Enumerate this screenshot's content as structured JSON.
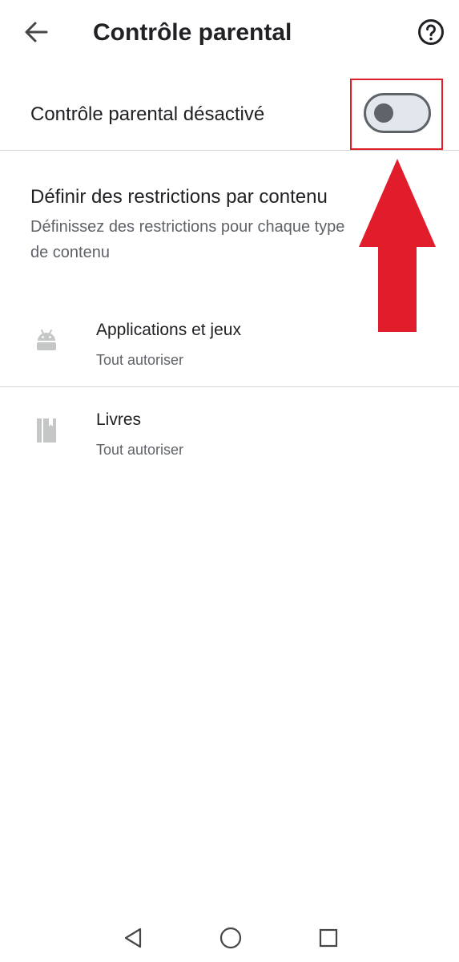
{
  "app_bar": {
    "title": "Contrôle parental",
    "back_icon": "arrow-back-icon",
    "help_icon": "help-circle-icon"
  },
  "parental_toggle": {
    "label": "Contrôle parental désactivé",
    "enabled": false
  },
  "restrictions": {
    "title": "Définir des restrictions par contenu",
    "description": "Définissez des restrictions pour chaque type de contenu"
  },
  "content_items": [
    {
      "title": "Applications et jeux",
      "subtitle": "Tout autoriser",
      "icon": "android-icon"
    },
    {
      "title": "Livres",
      "subtitle": "Tout autoriser",
      "icon": "book-icon"
    }
  ],
  "annotation": {
    "color": "#e11d2b"
  },
  "system_nav": {
    "back_icon": "nav-back-triangle-icon",
    "home_icon": "nav-home-circle-icon",
    "recents_icon": "nav-recents-square-icon"
  }
}
